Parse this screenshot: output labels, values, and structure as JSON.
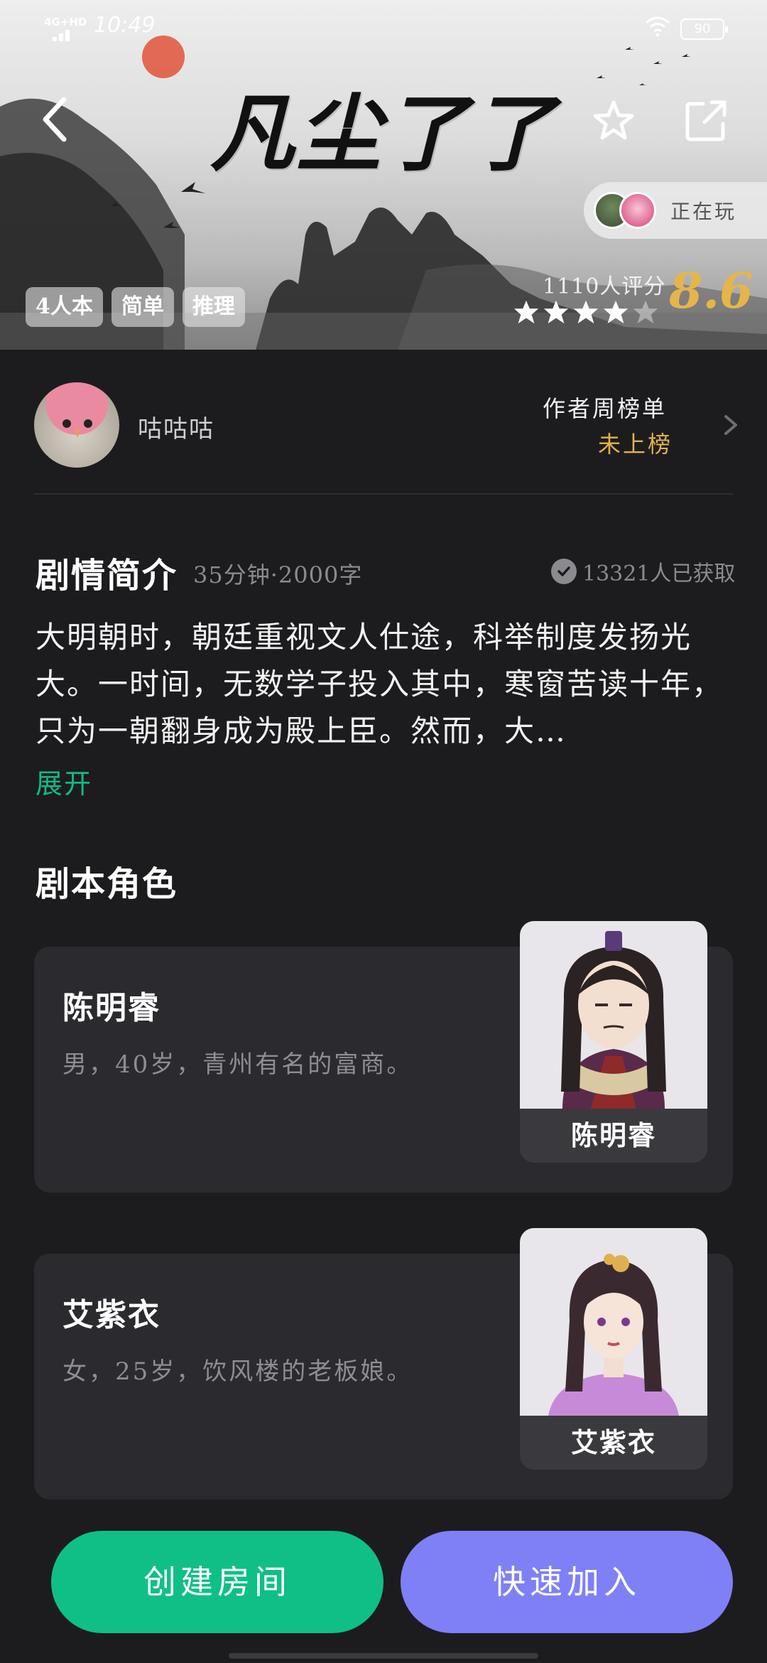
{
  "status_bar": {
    "network": "4G+HD",
    "time": "10:49",
    "battery": "90"
  },
  "hero": {
    "title": "凡尘了了",
    "playing_label": "正在玩",
    "tags": [
      "4人本",
      "简单",
      "推理"
    ],
    "rating_count": "1110人评分",
    "score": "8.6",
    "stars_filled": 4,
    "stars_total": 5
  },
  "author": {
    "name": "咕咕咕",
    "rank_title": "作者周榜单",
    "rank_status": "未上榜"
  },
  "synopsis": {
    "title": "剧情简介",
    "meta": "35分钟·2000字",
    "obtained": "13321人已获取",
    "text": "大明朝时，朝廷重视文人仕途，科举制度发扬光大。一时间，无数学子投入其中，寒窗苦读十年，只为一朝翻身成为殿上臣。然而，大…",
    "expand_label": "展开"
  },
  "roles": {
    "title": "剧本角色",
    "items": [
      {
        "name": "陈明睿",
        "description": "男，40岁，青州有名的富商。",
        "portrait_label": "陈明睿"
      },
      {
        "name": "艾紫衣",
        "description": "女，25岁，饮风楼的老板娘。",
        "portrait_label": "艾紫衣"
      }
    ]
  },
  "actions": {
    "create_room": "创建房间",
    "quick_join": "快速加入"
  },
  "colors": {
    "accent_green": "#10bf86",
    "accent_purple": "#7f80f6",
    "score_gold": "#e6b54a",
    "background": "#1c1c1f"
  }
}
